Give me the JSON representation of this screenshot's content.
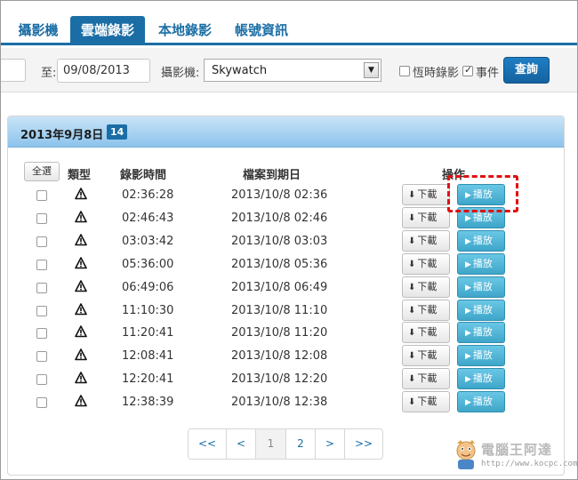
{
  "tabs": [
    {
      "label": "攝影機",
      "active": false
    },
    {
      "label": "雲端錄影",
      "active": true
    },
    {
      "label": "本地錄影",
      "active": false
    },
    {
      "label": "帳號資訊",
      "active": false
    }
  ],
  "filters": {
    "to_label": "至:",
    "to_date": "09/08/2013",
    "camera_label": "攝影機:",
    "camera_value": "Skywatch",
    "scheduled_label": "恆時錄影",
    "scheduled_checked": false,
    "event_label": "事件",
    "event_checked": true,
    "query_label": "查詢"
  },
  "panel": {
    "title": "2013年9月8日",
    "count": "14"
  },
  "table": {
    "select_all": "全選",
    "headers": {
      "type": "類型",
      "time": "錄影時間",
      "expiry": "檔案到期日",
      "actions": "操作"
    },
    "download_label": "下載",
    "play_label": "播放",
    "rows": [
      {
        "time": "02:36:28",
        "expiry": "2013/10/8 02:36"
      },
      {
        "time": "02:46:43",
        "expiry": "2013/10/8 02:46"
      },
      {
        "time": "03:03:42",
        "expiry": "2013/10/8 03:03"
      },
      {
        "time": "05:36:00",
        "expiry": "2013/10/8 05:36"
      },
      {
        "time": "06:49:06",
        "expiry": "2013/10/8 06:49"
      },
      {
        "time": "11:10:30",
        "expiry": "2013/10/8 11:10"
      },
      {
        "time": "11:20:41",
        "expiry": "2013/10/8 11:20"
      },
      {
        "time": "12:08:41",
        "expiry": "2013/10/8 12:08"
      },
      {
        "time": "12:20:41",
        "expiry": "2013/10/8 12:20"
      },
      {
        "time": "12:38:39",
        "expiry": "2013/10/8 12:38"
      }
    ]
  },
  "pagination": {
    "first": "<<",
    "prev": "<",
    "pages": [
      "1",
      "2"
    ],
    "current": "1",
    "next": ">",
    "last": ">>"
  },
  "watermark": {
    "text": "電腦王阿達",
    "url": "http://www.kocpc.com.tw"
  },
  "icons": {
    "type": "warning-icon",
    "download": "download-icon",
    "play": "play-icon"
  },
  "colors": {
    "brand": "#1b6ea5",
    "play": "#3ea6c9",
    "highlight": "#e01010"
  }
}
